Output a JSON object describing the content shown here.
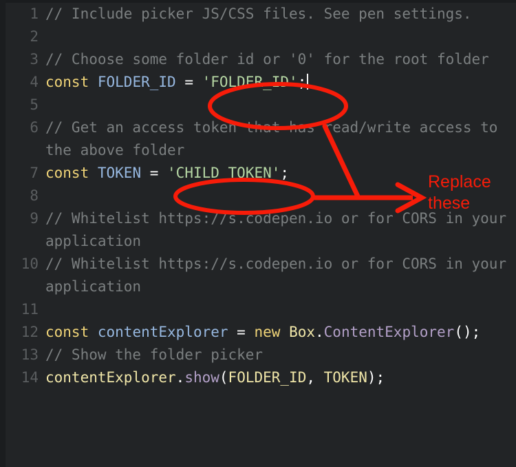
{
  "editor": {
    "theme_background": "#222426",
    "gutter_color": "#5b5e60",
    "lines": [
      {
        "number": "1",
        "segments": [
          {
            "kind": "comment",
            "text": "// Include picker JS/CSS files. See pen settings."
          }
        ]
      },
      {
        "number": "2",
        "segments": [
          {
            "kind": "plain",
            "text": ""
          }
        ]
      },
      {
        "number": "3",
        "segments": [
          {
            "kind": "comment",
            "text": "// Choose some folder id or '0' for the root folder"
          }
        ]
      },
      {
        "number": "4",
        "segments": [
          {
            "kind": "keyword",
            "text": "const"
          },
          {
            "kind": "plain",
            "text": " "
          },
          {
            "kind": "var",
            "text": "FOLDER_ID"
          },
          {
            "kind": "plain",
            "text": " = "
          },
          {
            "kind": "string",
            "text": "'FOLDER_ID'"
          },
          {
            "kind": "punct",
            "text": ";"
          },
          {
            "kind": "caret",
            "text": ""
          }
        ]
      },
      {
        "number": "5",
        "segments": [
          {
            "kind": "plain",
            "text": ""
          }
        ]
      },
      {
        "number": "6",
        "segments": [
          {
            "kind": "comment",
            "text": "// Get an access token that has read/write access to the above folder"
          }
        ]
      },
      {
        "number": "7",
        "segments": [
          {
            "kind": "keyword",
            "text": "const"
          },
          {
            "kind": "plain",
            "text": " "
          },
          {
            "kind": "var",
            "text": "TOKEN"
          },
          {
            "kind": "plain",
            "text": " = "
          },
          {
            "kind": "string",
            "text": "'CHILD_TOKEN'"
          },
          {
            "kind": "punct",
            "text": ";"
          }
        ]
      },
      {
        "number": "8",
        "segments": [
          {
            "kind": "plain",
            "text": ""
          }
        ]
      },
      {
        "number": "9",
        "segments": [
          {
            "kind": "comment",
            "text": "// Whitelist https://s.codepen.io or for CORS in your application"
          }
        ]
      },
      {
        "number": "10",
        "segments": [
          {
            "kind": "comment",
            "text": "// Whitelist https://s.codepen.io or for CORS in your application"
          }
        ]
      },
      {
        "number": "11",
        "segments": [
          {
            "kind": "plain",
            "text": ""
          }
        ]
      },
      {
        "number": "12",
        "segments": [
          {
            "kind": "keyword",
            "text": "const"
          },
          {
            "kind": "plain",
            "text": " "
          },
          {
            "kind": "var",
            "text": "contentExplorer"
          },
          {
            "kind": "plain",
            "text": " = "
          },
          {
            "kind": "keyword",
            "text": "new"
          },
          {
            "kind": "plain",
            "text": " "
          },
          {
            "kind": "ident",
            "text": "Box"
          },
          {
            "kind": "punct",
            "text": "."
          },
          {
            "kind": "method",
            "text": "ContentExplorer"
          },
          {
            "kind": "punct",
            "text": "();"
          }
        ]
      },
      {
        "number": "13",
        "segments": [
          {
            "kind": "comment",
            "text": "// Show the folder picker"
          }
        ]
      },
      {
        "number": "14",
        "segments": [
          {
            "kind": "ident",
            "text": "contentExplorer"
          },
          {
            "kind": "punct",
            "text": "."
          },
          {
            "kind": "method",
            "text": "show"
          },
          {
            "kind": "punct",
            "text": "("
          },
          {
            "kind": "ident",
            "text": "FOLDER_ID"
          },
          {
            "kind": "punct",
            "text": ", "
          },
          {
            "kind": "ident",
            "text": "TOKEN"
          },
          {
            "kind": "punct",
            "text": ");"
          }
        ]
      }
    ]
  },
  "annotations": {
    "color": "#f71c09",
    "replace_these_label": "Replace\nthese",
    "replace_these_line1": "Replace",
    "replace_these_line2": "these",
    "ellipse_folder_id_target": "'FOLDER_ID';",
    "ellipse_child_token_target": "'CHILD_TOKEN'"
  }
}
